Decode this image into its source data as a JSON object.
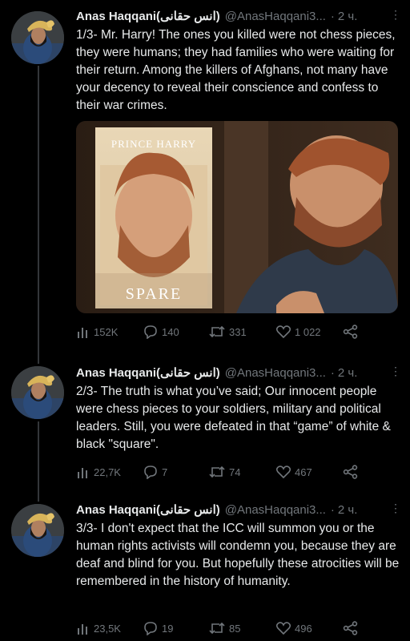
{
  "tweets": [
    {
      "author": "Anas Haqqani(انس حقانی)",
      "handle": "@AnasHaqqani3...",
      "time": "2 ч.",
      "text": "1/3- Mr. Harry! The ones you killed were not chess pieces, they were humans; they had families who were waiting for their return. Among the killers of Afghans, not many have your decency to reveal their conscience and confess to their war crimes.",
      "book_author": "PRINCE HARRY",
      "book_title": "SPARE",
      "views": "152K",
      "replies": "140",
      "retweets": "331",
      "likes": "1 022"
    },
    {
      "author": "Anas Haqqani(انس حقانی)",
      "handle": "@AnasHaqqani3...",
      "time": "2 ч.",
      "text": "2/3- The truth is what you’ve said; Our innocent people were chess pieces to your soldiers, military and political leaders. Still, you were defeated in that “game” of white & black \"square\".",
      "views": "22,7K",
      "replies": "7",
      "retweets": "74",
      "likes": "467"
    },
    {
      "author": "Anas Haqqani(انس حقانی)",
      "handle": "@AnasHaqqani3...",
      "time": "2 ч.",
      "text": "3/3-  I don't expect that the ICC will summon you or the human rights activists will condemn you, because they are deaf and blind for you. But hopefully these atrocities will be remembered in the history of humanity.",
      "views": "23,5K",
      "replies": "19",
      "retweets": "85",
      "likes": "496"
    }
  ],
  "icons": {
    "views": "bar-chart-icon",
    "reply": "speech-bubble-icon",
    "retweet": "retweet-arrows-icon",
    "like": "heart-icon",
    "share": "share-nodes-icon",
    "more": "more-dots-icon"
  },
  "colors": {
    "background": "#000000",
    "text": "#e7e9ea",
    "secondary": "#71767b",
    "thread_line": "#333639"
  }
}
